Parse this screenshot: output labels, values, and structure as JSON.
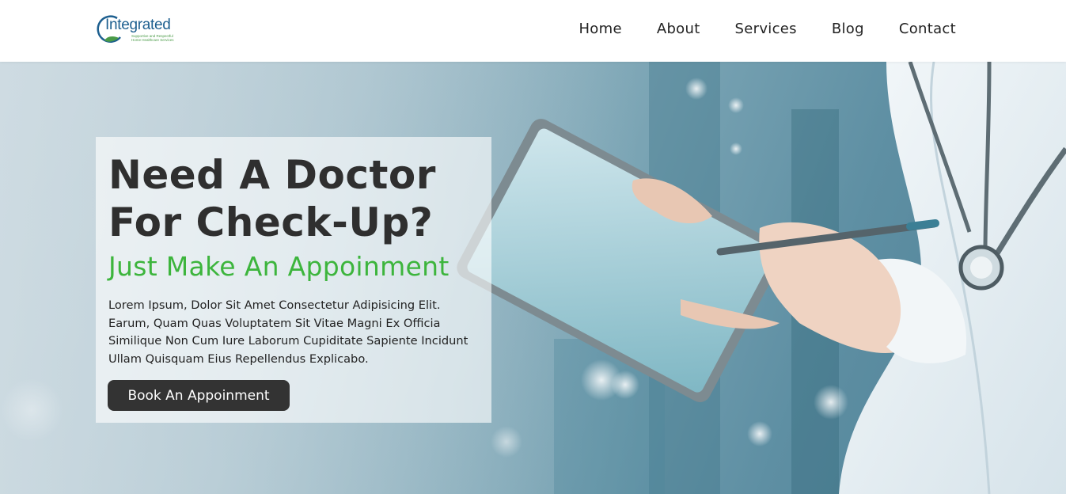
{
  "header": {
    "logo": {
      "name": "Integrated",
      "tagline_line1": "Supportive and Respectful",
      "tagline_line2": "Home Healthcare Services"
    },
    "nav": [
      {
        "label": "Home"
      },
      {
        "label": "About"
      },
      {
        "label": "Services"
      },
      {
        "label": "Blog"
      },
      {
        "label": "Contact"
      }
    ]
  },
  "hero": {
    "title_line1": "Need A Doctor",
    "title_line2": "For Check-Up?",
    "subtitle": "Just Make An Appoinment",
    "description": "Lorem Ipsum, Dolor Sit Amet Consectetur Adipisicing Elit. Earum, Quam Quas Voluptatem Sit Vitae Magni Ex Officia Similique Non Cum Iure Laborum Cupiditate Sapiente Incidunt Ullam Quisquam Eius Repellendus Explicabo.",
    "cta_label": "Book An Appoinment",
    "background": "doctor-with-tablet-photo"
  },
  "colors": {
    "accent_green": "#3db53d",
    "dark": "#333333",
    "logo_blue": "#1d5f8f"
  }
}
